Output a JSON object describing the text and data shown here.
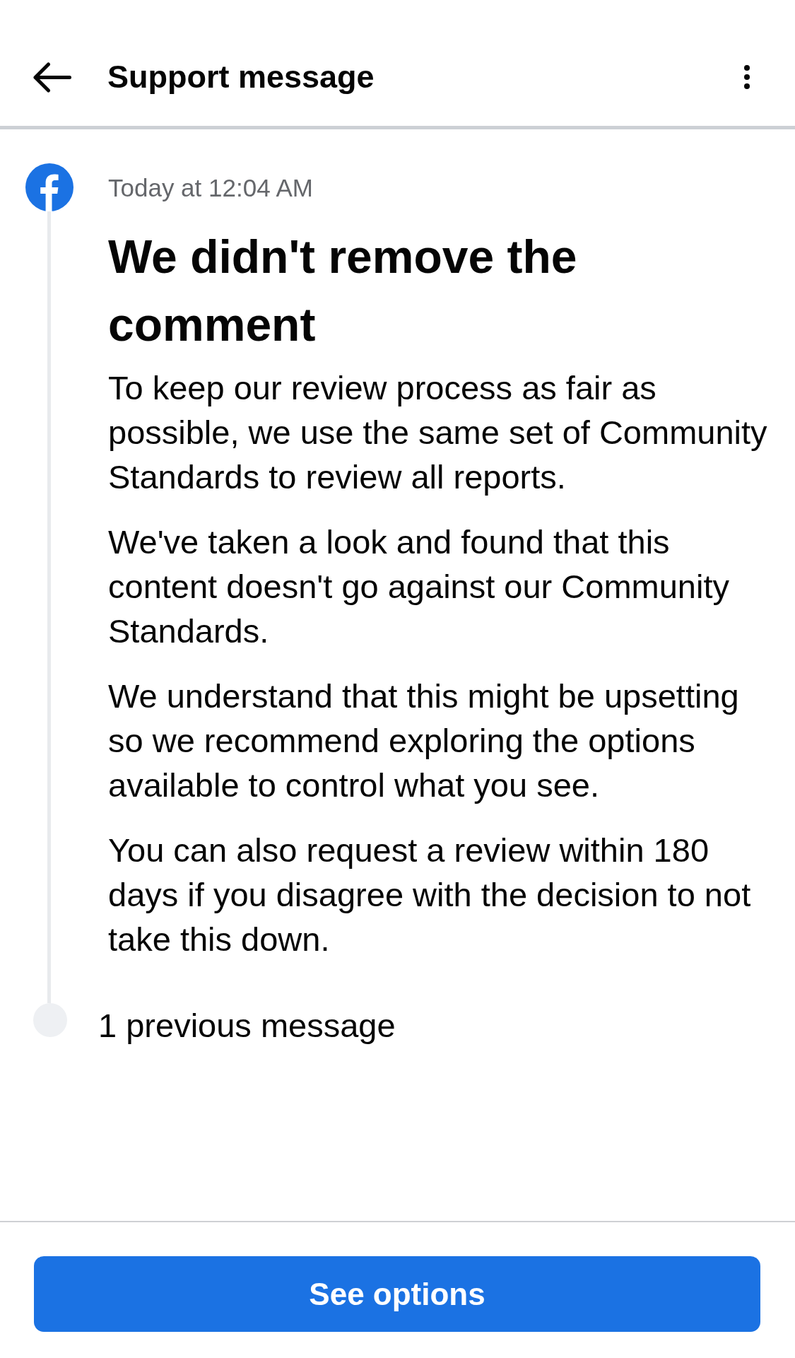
{
  "header": {
    "title": "Support message"
  },
  "message": {
    "timestamp": "Today at 12:04 AM",
    "heading": "We didn't remove the comment",
    "paragraphs": [
      "To keep our review process as fair as possible, we use the same set of Community Standards to review all reports.",
      "We've taken a look and found that this content doesn't go against our Community Standards.",
      "We understand that this might be upsetting so we recommend exploring the options available to control what you see.",
      "You can also request a review within 180 days if you disagree with the decision to not take this down."
    ]
  },
  "previous": {
    "label": "1 previous message"
  },
  "footer": {
    "button": "See options"
  }
}
